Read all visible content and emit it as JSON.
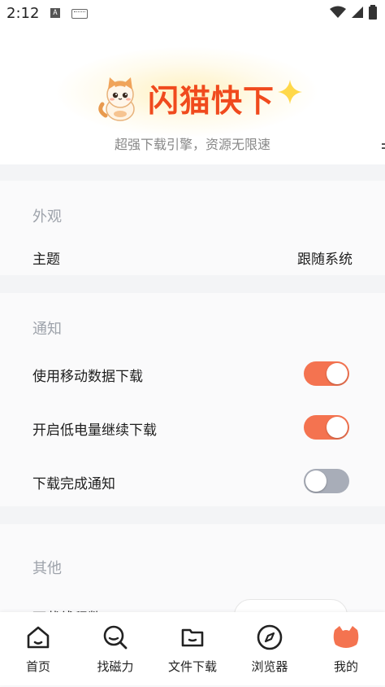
{
  "status_bar": {
    "time": "2:12",
    "ime_letter": "A"
  },
  "header": {
    "app_name": "闪猫快下",
    "tagline": "超强下载引擎，资源无限速"
  },
  "appearance": {
    "section_title": "外观",
    "theme_label": "主题",
    "theme_value": "跟随系统"
  },
  "notifications": {
    "section_title": "通知",
    "items": [
      {
        "label": "使用移动数据下载",
        "enabled": true
      },
      {
        "label": "开启低电量继续下载",
        "enabled": true
      },
      {
        "label": "下载完成通知",
        "enabled": false
      }
    ]
  },
  "other": {
    "section_title": "其他",
    "partial_row_label": "下载线程数"
  },
  "bottom_nav": {
    "items": [
      {
        "label": "首页",
        "icon": "home-icon"
      },
      {
        "label": "找磁力",
        "icon": "magnet-search-icon"
      },
      {
        "label": "文件下载",
        "icon": "folder-icon"
      },
      {
        "label": "浏览器",
        "icon": "compass-icon"
      },
      {
        "label": "我的",
        "icon": "cat-avatar-icon"
      }
    ]
  },
  "colors": {
    "accent": "#f47350",
    "brand_title": "#f04a1d",
    "toggle_off": "#a8adb8",
    "section_title": "#9ea3ab",
    "background": "#f3f4f6"
  }
}
